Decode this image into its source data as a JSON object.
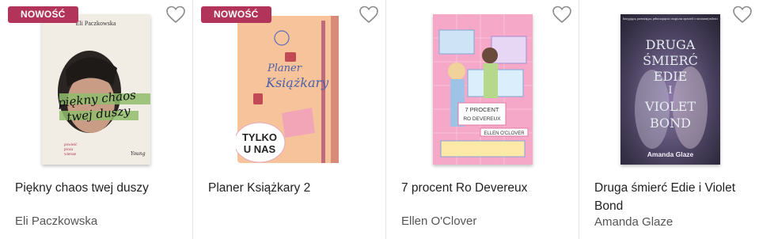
{
  "products": [
    {
      "badge": "NOWOŚĆ",
      "title": "Piękny chaos twej duszy",
      "author": "Eli Paczkowska",
      "cover": {
        "author": "Eli Paczkowska",
        "line1": "piękny chaos",
        "line2": "twej duszy",
        "sub1": "powieść",
        "sub2": "proza",
        "sub3": "wiersze",
        "publisher": "Young",
        "bg": "#f1ece4"
      }
    },
    {
      "badge": "NOWOŚĆ",
      "title": "Planer Książkary 2",
      "author": "",
      "cover": {
        "line1": "Planer",
        "line2": "Książkary",
        "sticker1": "TYLKO",
        "sticker2": "U NAS",
        "bg": "#f6c39b"
      }
    },
    {
      "badge": "",
      "title": "7 procent Ro Devereux",
      "author": "Ellen O'Clover",
      "cover": {
        "line1": "7 PROCENT",
        "line2": "RO DEVEREUX",
        "author": "ELLEN O'CLOVER",
        "bg": "#f5a8c8"
      }
    },
    {
      "badge": "",
      "title": "Druga śmierć Edie i Violet Bond",
      "author": "Amanda Glaze",
      "cover": {
        "line1": "DRUGA",
        "line2": "ŚMIERĆ",
        "line3": "EDIE",
        "line4": "I",
        "line5": "VIOLET",
        "line6": "BOND",
        "author": "Amanda Glaze",
        "blurb": "Intrygująca, przerażająca, pełna napięcia i magiczna opowieść o siostrzanej miłości",
        "bg": "#3a3547"
      }
    }
  ],
  "colors": {
    "badge": "#b2345a",
    "heart": "#8a8a8a",
    "divider": "#e4e4e4"
  },
  "icons": {
    "wishlist": "heart-outline-icon"
  }
}
